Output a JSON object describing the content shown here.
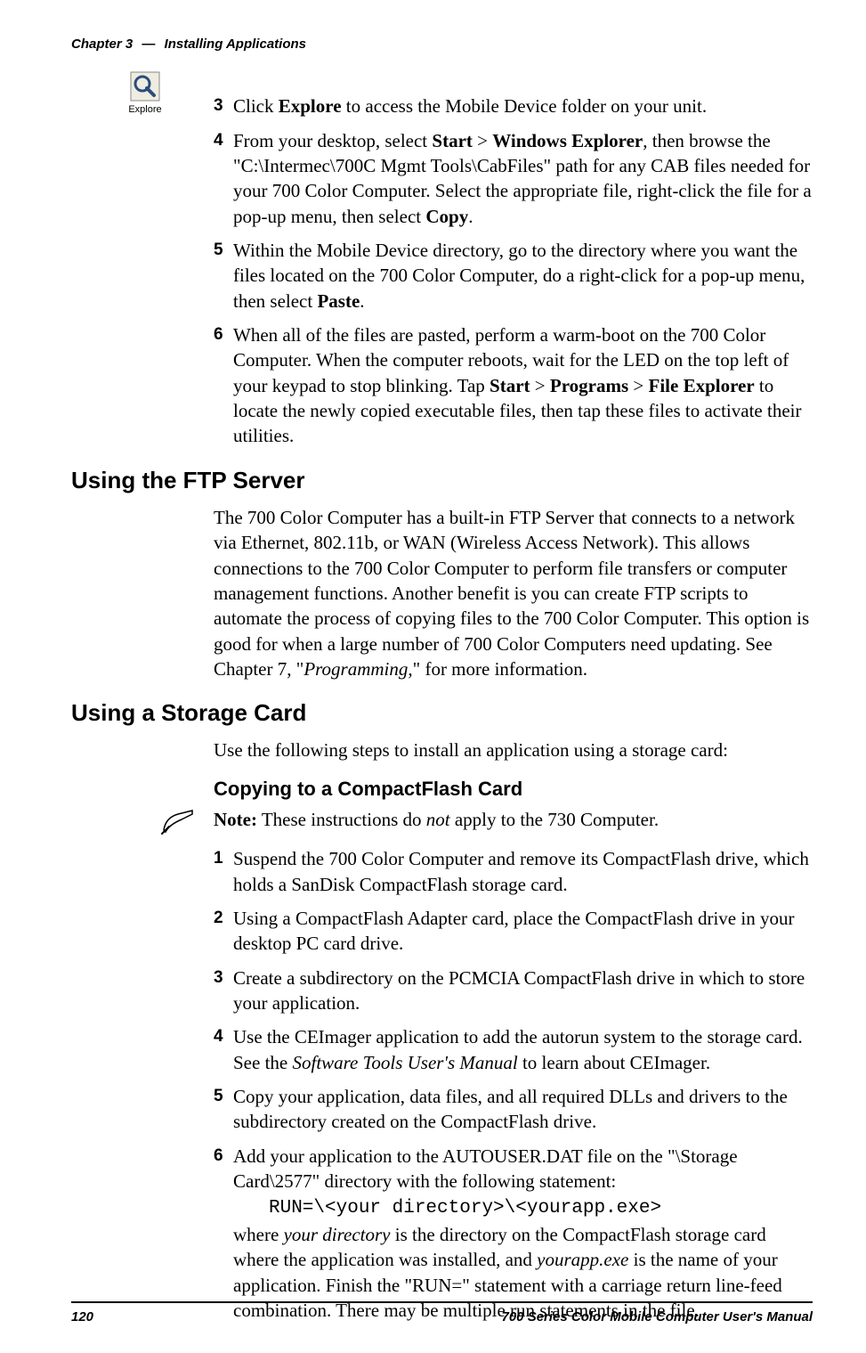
{
  "header": {
    "chapter": "Chapter 3",
    "title": "Installing Applications"
  },
  "explore_icon_label": "Explore",
  "top_steps": {
    "s3": {
      "num": "3",
      "pre": "Click ",
      "b1": "Explore",
      "post": " to access the Mobile Device folder on your unit."
    },
    "s4": {
      "num": "4",
      "t1": "From your desktop, select ",
      "b1": "Start",
      "t2": " > ",
      "b2": "Windows Explorer",
      "t3": ", then browse the \"C:\\Intermec\\700C Mgmt Tools\\CabFiles\" path for any CAB files needed for your 700 Color Computer. Select the appropriate file, right-click the file for a pop-up menu, then select ",
      "b3": "Copy",
      "t4": "."
    },
    "s5": {
      "num": "5",
      "t1": "Within the Mobile Device directory, go to the directory where you want the files located on the 700 Color Computer, do a right-click for a pop-up menu, then select ",
      "b1": "Paste",
      "t2": "."
    },
    "s6": {
      "num": "6",
      "t1": "When all of the files are pasted, perform a warm-boot on the 700 Color Computer. When the computer reboots, wait for the LED on the top left of your keypad to stop blinking. Tap ",
      "b1": "Start",
      "t2": " > ",
      "b2": "Programs",
      "t3": " > ",
      "b3": "File Explorer",
      "t4": " to locate the newly copied executable files, then tap these files to activate their utilities."
    }
  },
  "ftp": {
    "heading": "Using the FTP Server",
    "body_pre": "The 700 Color Computer has a built-in FTP Server that connects to a network via Ethernet, 802.11b, or WAN (Wireless Access Network). This allows connections to the 700 Color Computer to perform file transfers or computer management functions. Another benefit is you can create FTP scripts to automate the process of copying files to the 700 Color Computer. This option is good for when a large number of 700 Color Computers need updating. See Chapter 7, \"",
    "body_ital": "Programming",
    "body_post": ",\" for more information."
  },
  "storage": {
    "heading": "Using a Storage Card",
    "intro": "Use the following steps to install an application using a storage card:",
    "sub_heading": "Copying to a CompactFlash Card",
    "note": {
      "label": "Note:",
      "t1": " These instructions do ",
      "ital": "not",
      "t2": " apply to the 730 Computer."
    },
    "steps": {
      "s1": {
        "num": "1",
        "txt": "Suspend the 700 Color Computer and remove its CompactFlash drive, which holds a SanDisk CompactFlash storage card."
      },
      "s2": {
        "num": "2",
        "txt": "Using a CompactFlash Adapter card, place the CompactFlash drive in your desktop PC card drive."
      },
      "s3": {
        "num": "3",
        "txt": "Create a subdirectory on the PCMCIA CompactFlash drive in which to store your application."
      },
      "s4": {
        "num": "4",
        "t1": "Use the CEImager application to add the autorun system to the storage card. See the ",
        "ital": "Software Tools User's Manual",
        "t2": " to learn about CEImager."
      },
      "s5": {
        "num": "5",
        "txt": "Copy your application, data files, and all required DLLs and drivers to the subdirectory created on the CompactFlash drive."
      },
      "s6": {
        "num": "6",
        "t1": "Add your application to the AUTOUSER.DAT file on the \"\\Storage Card\\2577\" directory with the following statement:",
        "code": "RUN=\\<your directory>\\<yourapp.exe>",
        "t2a": "where ",
        "i1": "your directory",
        "t2b": " is the directory on the CompactFlash storage card where the application was installed, and ",
        "i2": "yourapp.exe",
        "t2c": " is the name of your application. Finish the \"RUN=\" statement with a carriage return line-feed combination. There may be multiple run statements in the file."
      }
    }
  },
  "footer": {
    "page": "120",
    "title": "700 Series Color Mobile Computer User's Manual"
  }
}
